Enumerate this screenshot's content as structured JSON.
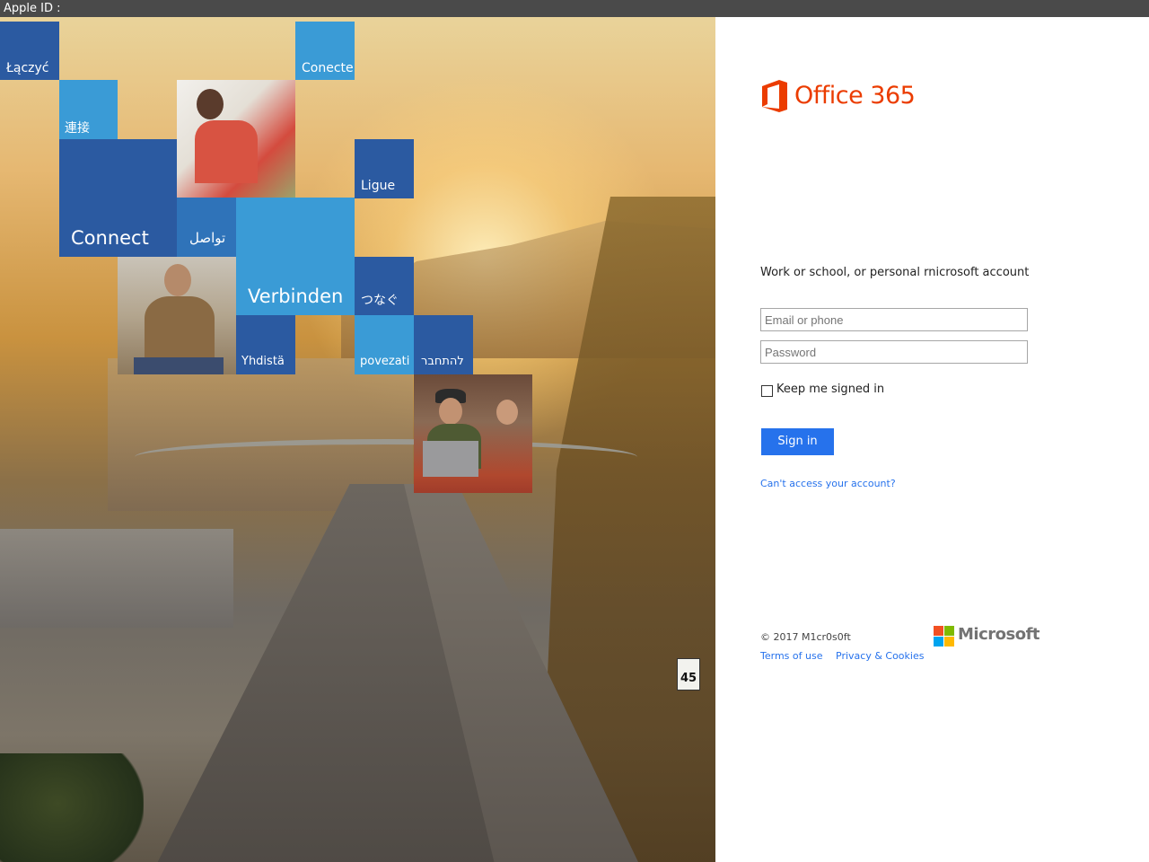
{
  "topbar": {
    "label": "Apple ID :"
  },
  "hero": {
    "tiles": {
      "laczyc": "Łączyć",
      "conecte": "Conecte",
      "lianjie": "連接",
      "ligue": "Ligue",
      "connect": "Connect",
      "tawasal": "تواصل",
      "verbinden": "Verbinden",
      "tsunagu": "つなぐ",
      "yhdista": "Yhdistä",
      "povezati": "povezati",
      "lehitchaber": "להתחבר"
    },
    "speed_sign": "45"
  },
  "signin": {
    "brand": "Office 365",
    "heading": "Work or school, or personal rnicrosoft account",
    "email_placeholder": "Email or phone",
    "password_placeholder": "Password",
    "keep_signed_in": "Keep me signed in",
    "button": "Sign in",
    "cant_access": "Can't access your account?"
  },
  "footer": {
    "copyright": "© 2017 M1cr0s0ft",
    "terms": "Terms of use",
    "privacy": "Privacy & Cookies",
    "brand": "Microsoft"
  },
  "colors": {
    "office_orange": "#eb3c00",
    "accent_blue": "#2672ec",
    "ms_red": "#f25022",
    "ms_green": "#7fba00",
    "ms_blue": "#00a4ef",
    "ms_yellow": "#ffb900"
  }
}
